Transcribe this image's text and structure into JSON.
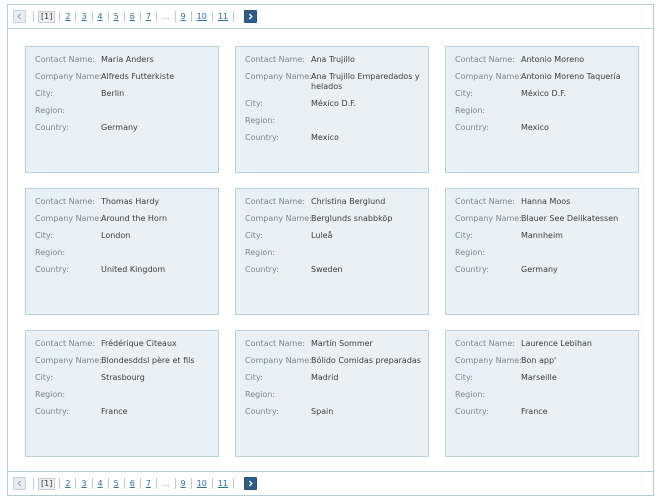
{
  "labels": {
    "contact": "Contact Name:",
    "company": "Company Name:",
    "city": "City:",
    "region": "Region:",
    "country": "Country:"
  },
  "pager": {
    "current": "[1]",
    "pages": [
      "2",
      "3",
      "4",
      "5",
      "6",
      "7",
      "...",
      "9",
      "10",
      "11"
    ]
  },
  "cards": [
    {
      "contact": "Maria Anders",
      "company": "Alfreds Futterkiste",
      "city": "Berlin",
      "region": "",
      "country": "Germany"
    },
    {
      "contact": "Ana Trujillo",
      "company": "Ana Trujillo Emparedados y helados",
      "city": "México D.F.",
      "region": "",
      "country": "Mexico"
    },
    {
      "contact": "Antonio Moreno",
      "company": "Antonio Moreno Taquería",
      "city": "México D.F.",
      "region": "",
      "country": "Mexico"
    },
    {
      "contact": "Thomas Hardy",
      "company": "Around the Horn",
      "city": "London",
      "region": "",
      "country": "United Kingdom"
    },
    {
      "contact": "Christina Berglund",
      "company": "Berglunds snabbköp",
      "city": "Luleå",
      "region": "",
      "country": "Sweden"
    },
    {
      "contact": "Hanna Moos",
      "company": "Blauer See Delikatessen",
      "city": "Mannheim",
      "region": "",
      "country": "Germany"
    },
    {
      "contact": "Frédérique Citeaux",
      "company": "Blondesddsl père et fils",
      "city": "Strasbourg",
      "region": "",
      "country": "France"
    },
    {
      "contact": "Martín Sommer",
      "company": "Bólido Comidas preparadas",
      "city": "Madrid",
      "region": "",
      "country": "Spain"
    },
    {
      "contact": "Laurence Lebihan",
      "company": "Bon app'",
      "city": "Marseille",
      "region": "",
      "country": "France"
    }
  ],
  "icons": {
    "prev": "chevron-left-icon",
    "next": "chevron-right-icon"
  },
  "colors": {
    "card_bg": "#eaf1f6",
    "card_border": "#bccfdd",
    "link": "#2a6ea6",
    "next_button": "#2f5d88"
  }
}
